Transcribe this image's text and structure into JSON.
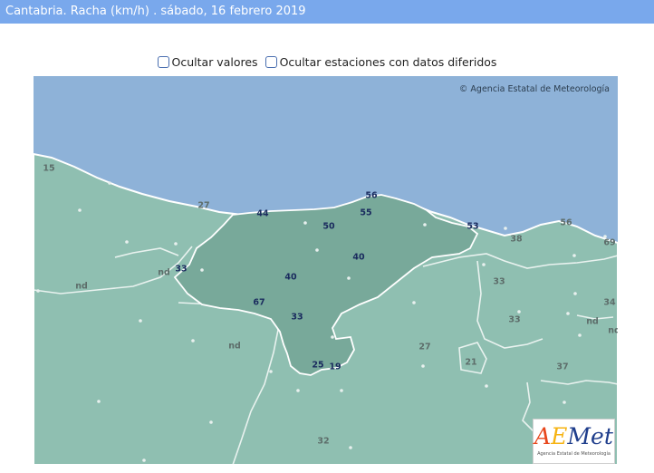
{
  "header": {
    "title": "Cantabria. Racha (km/h) . sábado, 16 febrero 2019"
  },
  "controls": {
    "hide_values": "Ocultar valores",
    "hide_deferred": "Ocultar estaciones con datos diferidos"
  },
  "map": {
    "copyright": "© Agencia Estatal de Meteorología",
    "logo_text": "AEMet",
    "logo_caption": "Agencia Estatal de Meteorología",
    "colors": {
      "sea": "#8eb2d8",
      "land": "#8fbfb1",
      "region": "#78a99a",
      "coast_line": "#ffffff"
    }
  },
  "stations": [
    {
      "label": "15",
      "inside": false
    },
    {
      "label": "27",
      "inside": false
    },
    {
      "label": "44",
      "inside": true
    },
    {
      "label": "56",
      "inside": true
    },
    {
      "label": "55",
      "inside": true
    },
    {
      "label": "50",
      "inside": true
    },
    {
      "label": "53",
      "inside": true
    },
    {
      "label": "56",
      "inside": false
    },
    {
      "label": "38",
      "inside": false
    },
    {
      "label": "69",
      "inside": false
    },
    {
      "label": "40",
      "inside": true
    },
    {
      "label": "nd",
      "inside": false
    },
    {
      "label": "33",
      "inside": true
    },
    {
      "label": "nd",
      "inside": false
    },
    {
      "label": "40",
      "inside": true
    },
    {
      "label": "33",
      "inside": false
    },
    {
      "label": "34",
      "inside": false
    },
    {
      "label": "67",
      "inside": true
    },
    {
      "label": "33",
      "inside": true
    },
    {
      "label": "33",
      "inside": false
    },
    {
      "label": "nd",
      "inside": false
    },
    {
      "label": "nd",
      "inside": false
    },
    {
      "label": "nd",
      "inside": false
    },
    {
      "label": "27",
      "inside": false
    },
    {
      "label": "21",
      "inside": false
    },
    {
      "label": "25",
      "inside": true
    },
    {
      "label": "19",
      "inside": true
    },
    {
      "label": "37",
      "inside": false
    },
    {
      "label": "32",
      "inside": false
    }
  ]
}
